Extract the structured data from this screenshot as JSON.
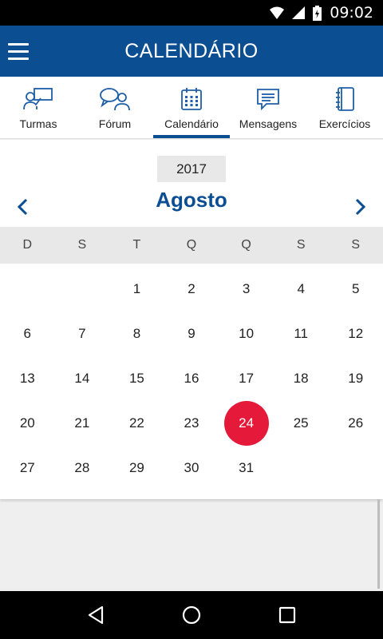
{
  "status_bar": {
    "time": "09:02"
  },
  "app_bar": {
    "title": "CALENDÁRIO"
  },
  "tabs": [
    {
      "label": "Turmas",
      "icon": "class-icon",
      "active": false
    },
    {
      "label": "Fórum",
      "icon": "forum-icon",
      "active": false
    },
    {
      "label": "Calendário",
      "icon": "calendar-icon",
      "active": true
    },
    {
      "label": "Mensagens",
      "icon": "messages-icon",
      "active": false
    },
    {
      "label": "Exercícios",
      "icon": "exercises-icon",
      "active": false
    }
  ],
  "calendar": {
    "year": "2017",
    "month": "Agosto",
    "weekdays": [
      "D",
      "S",
      "T",
      "Q",
      "Q",
      "S",
      "S"
    ],
    "weeks": [
      [
        "",
        "",
        "1",
        "2",
        "3",
        "4",
        "5"
      ],
      [
        "6",
        "7",
        "8",
        "9",
        "10",
        "11",
        "12"
      ],
      [
        "13",
        "14",
        "15",
        "16",
        "17",
        "18",
        "19"
      ],
      [
        "20",
        "21",
        "22",
        "23",
        "24",
        "25",
        "26"
      ],
      [
        "27",
        "28",
        "29",
        "30",
        "31",
        "",
        ""
      ]
    ],
    "selected_day": "24"
  },
  "colors": {
    "primary": "#0c4e92",
    "accent": "#e51a3b"
  }
}
